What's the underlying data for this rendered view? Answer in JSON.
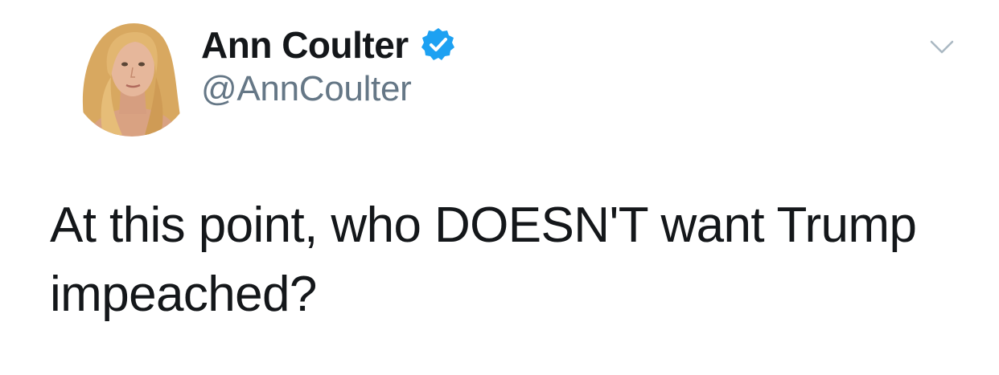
{
  "tweet": {
    "author": {
      "display_name": "Ann Coulter",
      "handle": "@AnnCoulter",
      "verified": true,
      "avatar_icon": "profile-photo"
    },
    "text": "At this point, who DOESN'T want Trump impeached?",
    "menu_icon": "chevron-down-icon"
  },
  "colors": {
    "text_primary": "#14171a",
    "text_secondary": "#657786",
    "verified_blue": "#1da1f2",
    "caret_gray": "#aab8c2",
    "background": "#ffffff"
  }
}
